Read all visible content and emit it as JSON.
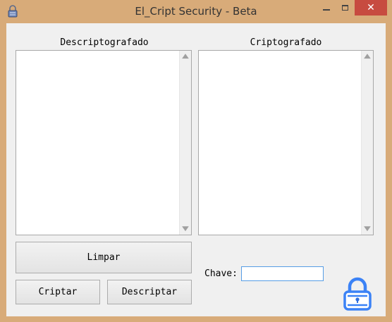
{
  "window": {
    "title": "El_Cript Security - Beta",
    "accent_close": "#c74b40",
    "frame_color": "#d8ab79",
    "icons": {
      "app": "lock-icon",
      "minimize": "minimize-icon",
      "maximize": "maximize-icon",
      "close": "close-icon"
    },
    "close_glyph": "✕"
  },
  "panels": {
    "decrypted": {
      "label": "Descriptografado",
      "value": ""
    },
    "encrypted": {
      "label": "Criptografado",
      "value": ""
    }
  },
  "scroll_arrows": {
    "up": "▲",
    "down": "▼"
  },
  "buttons": {
    "clear": "Limpar",
    "encrypt": "Criptar",
    "decrypt": "Descriptar"
  },
  "key": {
    "label": "Chave:",
    "value": ""
  },
  "brand_lock": {
    "icon": "padlock-icon",
    "color": "#3b82f6",
    "color_dark": "#2f6fe0"
  }
}
